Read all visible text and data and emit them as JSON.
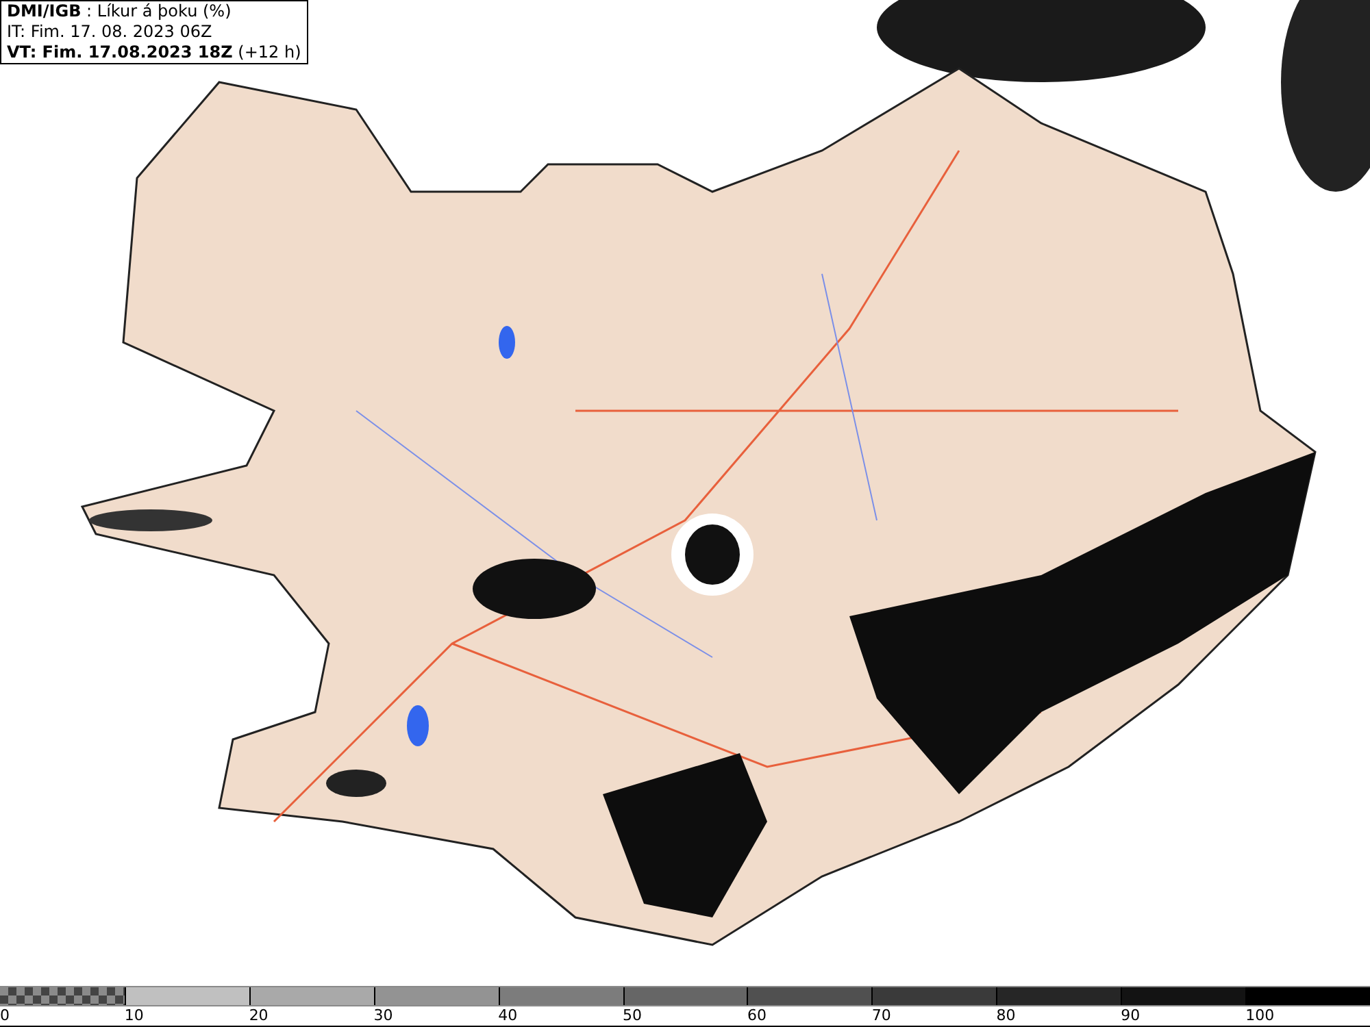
{
  "header": {
    "source": "DMI/IGB",
    "title": ": Líkur á þoku (%)",
    "issue": "IT: Fim. 17. 08. 2023 06Z",
    "valid": "VT: Fim. 17.08.2023 18Z",
    "offset": "(+12 h)"
  },
  "legend": {
    "segments": [
      {
        "kind": "checker",
        "color": "#8a8a8a"
      },
      {
        "kind": "solid",
        "color": "#c0c0c0"
      },
      {
        "kind": "solid",
        "color": "#a9a9a9"
      },
      {
        "kind": "solid",
        "color": "#939393"
      },
      {
        "kind": "solid",
        "color": "#7c7c7c"
      },
      {
        "kind": "solid",
        "color": "#666666"
      },
      {
        "kind": "solid",
        "color": "#505050"
      },
      {
        "kind": "solid",
        "color": "#3a3a3a"
      },
      {
        "kind": "solid",
        "color": "#262626"
      },
      {
        "kind": "solid",
        "color": "#131313"
      },
      {
        "kind": "solid",
        "color": "#000000"
      }
    ],
    "labels": [
      "0",
      "10",
      "20",
      "30",
      "40",
      "50",
      "60",
      "70",
      "80",
      "90",
      "100"
    ]
  }
}
